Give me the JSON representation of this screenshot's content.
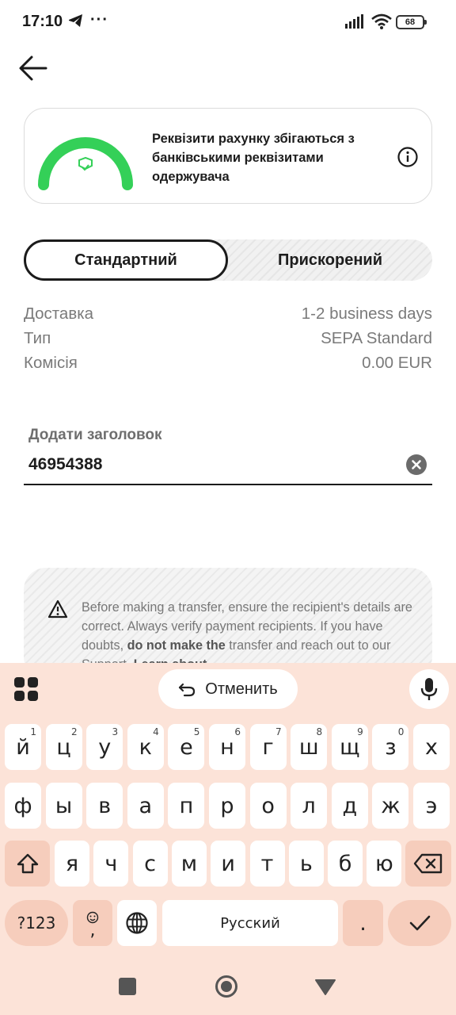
{
  "status": {
    "time": "17:10",
    "more": "···",
    "battery": "68"
  },
  "match_card": {
    "text": "Реквізити рахунку збігаються з банківськими реквізитами одержувача"
  },
  "delivery_options": {
    "standard": "Стандартний",
    "express": "Прискорений"
  },
  "details": [
    {
      "label": "Доставка",
      "value": "1-2 business days"
    },
    {
      "label": "Тип",
      "value": "SEPA Standard"
    },
    {
      "label": "Комісія",
      "value": "0.00 EUR"
    }
  ],
  "title_field": {
    "label": "Додати заголовок",
    "value": "46954388"
  },
  "warning": {
    "text_1": "Before making a transfer, ensure the recipient's details are correct. Always verify payment recipients. If you have doubts, ",
    "bold_1": "do not make the",
    "text_2": " transfer and reach out to our Support. ",
    "bold_2": "Learn about"
  },
  "keyboard": {
    "undo_label": "Отменить",
    "row1": [
      {
        "k": "й",
        "s": "1"
      },
      {
        "k": "ц",
        "s": "2"
      },
      {
        "k": "у",
        "s": "3"
      },
      {
        "k": "к",
        "s": "4"
      },
      {
        "k": "е",
        "s": "5"
      },
      {
        "k": "н",
        "s": "6"
      },
      {
        "k": "г",
        "s": "7"
      },
      {
        "k": "ш",
        "s": "8"
      },
      {
        "k": "щ",
        "s": "9"
      },
      {
        "k": "з",
        "s": "0"
      },
      {
        "k": "х",
        "s": ""
      }
    ],
    "row2": [
      "ф",
      "ы",
      "в",
      "а",
      "п",
      "р",
      "о",
      "л",
      "д",
      "ж",
      "э"
    ],
    "row3": [
      "я",
      "ч",
      "с",
      "м",
      "и",
      "т",
      "ь",
      "б",
      "ю"
    ],
    "symbols_label": "?123",
    "comma": ",",
    "space_label": "Русский",
    "period": "."
  },
  "colors": {
    "accent_green": "#34d058",
    "keyboard_bg": "#fce3d8",
    "key_alt": "#f6cdbc"
  }
}
